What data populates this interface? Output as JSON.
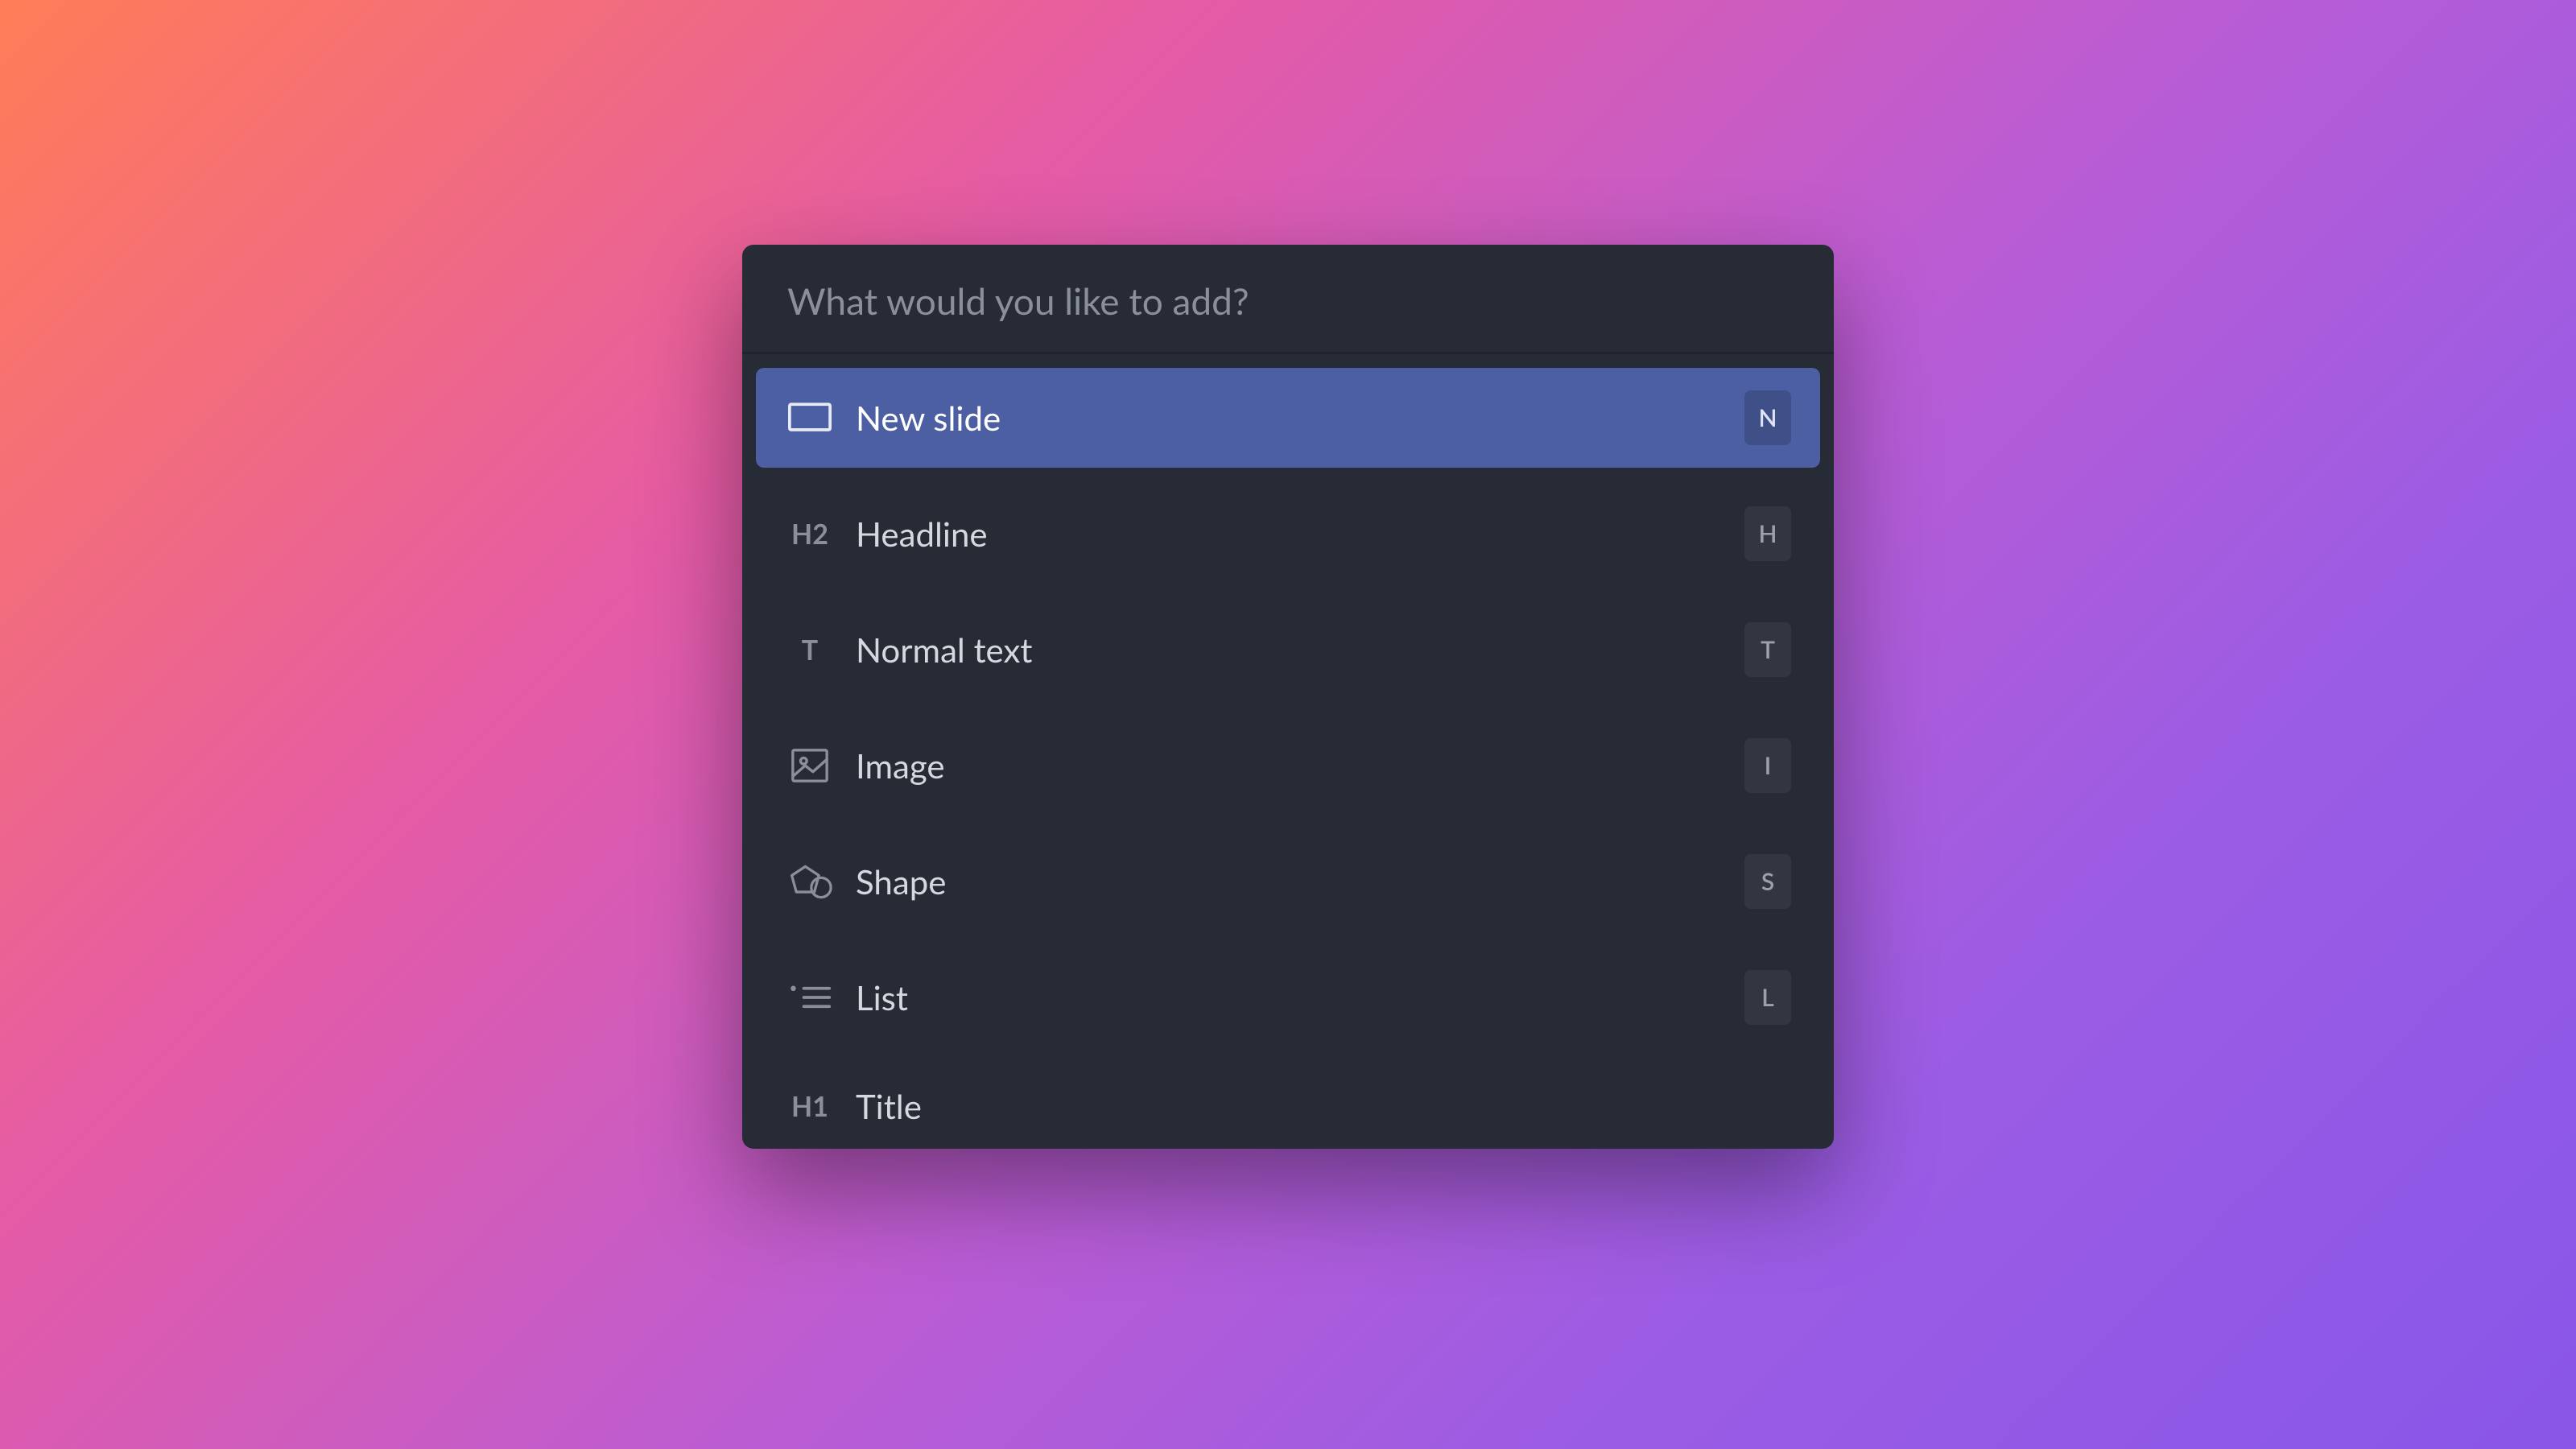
{
  "search": {
    "placeholder": "What would you like to add?",
    "value": ""
  },
  "items": [
    {
      "label": "New slide",
      "shortcut": "N",
      "icon": "slide-icon",
      "icon_text": ""
    },
    {
      "label": "Headline",
      "shortcut": "H",
      "icon": "h2-icon",
      "icon_text": "H2"
    },
    {
      "label": "Normal text",
      "shortcut": "T",
      "icon": "text-icon",
      "icon_text": "T"
    },
    {
      "label": "Image",
      "shortcut": "I",
      "icon": "image-icon",
      "icon_text": ""
    },
    {
      "label": "Shape",
      "shortcut": "S",
      "icon": "shape-icon",
      "icon_text": ""
    },
    {
      "label": "List",
      "shortcut": "L",
      "icon": "list-icon",
      "icon_text": ""
    },
    {
      "label": "Title",
      "shortcut": "",
      "icon": "h1-icon",
      "icon_text": "H1"
    }
  ],
  "selected_index": 0
}
